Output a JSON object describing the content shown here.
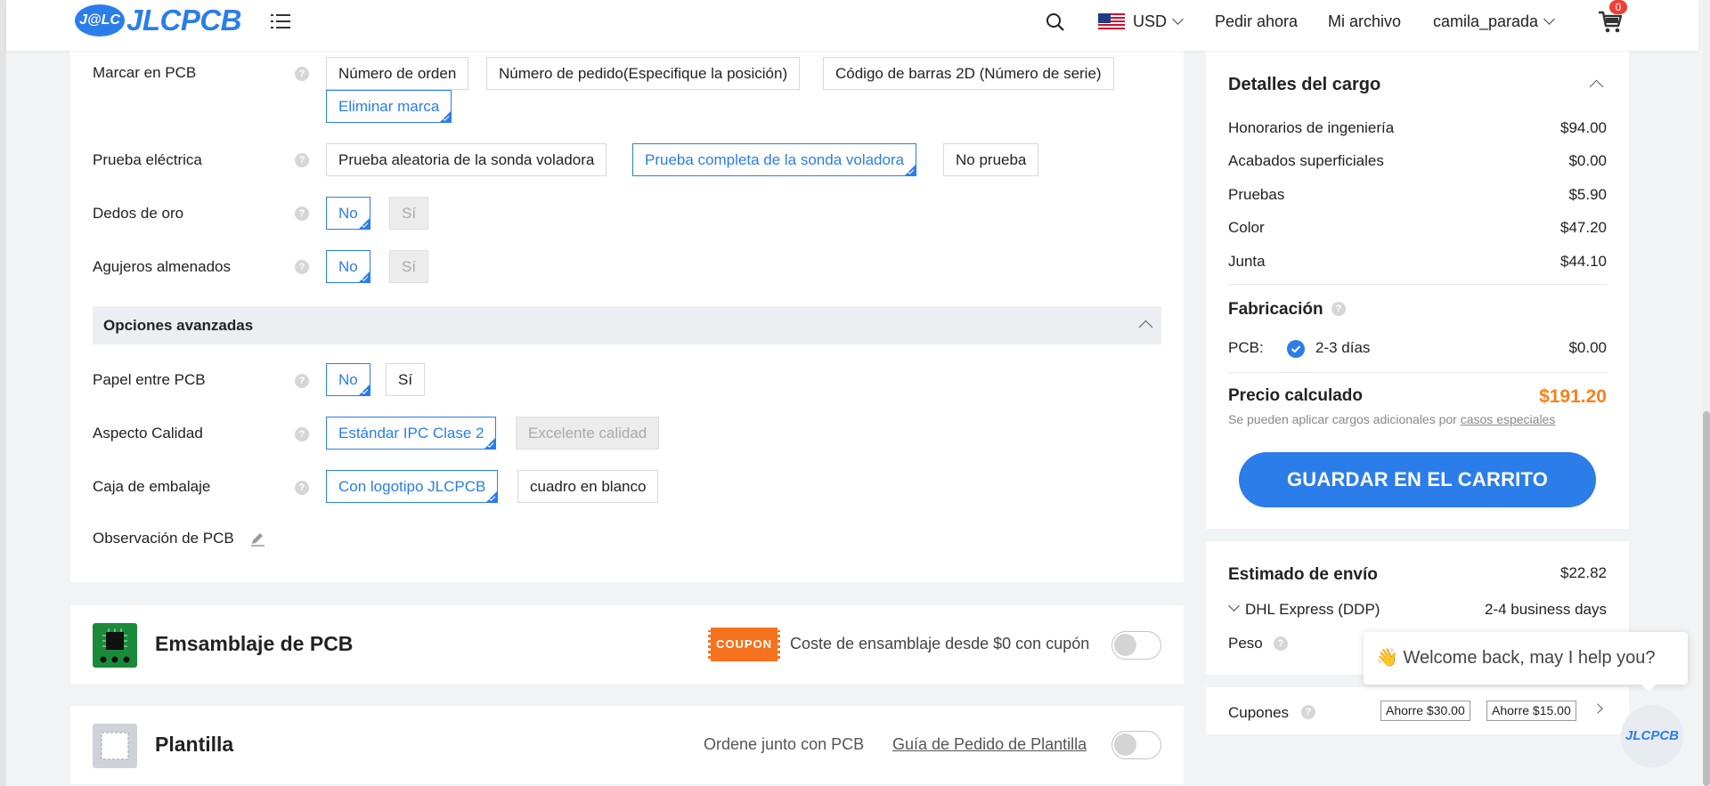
{
  "header": {
    "logo_badge": "J@LC",
    "logo_text": "JLCPCB",
    "currency": "USD",
    "order_now": "Pedir ahora",
    "my_files": "Mi archivo",
    "username": "camila_parada",
    "cart_count": "0"
  },
  "options": {
    "mark_pcb": {
      "label": "Marcar en PCB",
      "choices": [
        "Número de orden",
        "Número de pedido(Especifique la posición)",
        "Código de barras 2D (Número de serie)",
        "Eliminar marca"
      ],
      "selected": "Eliminar marca"
    },
    "electrical_test": {
      "label": "Prueba eléctrica",
      "choices": [
        "Prueba aleatoria de la sonda voladora",
        "Prueba completa de la sonda voladora",
        "No prueba"
      ],
      "selected": "Prueba completa de la sonda voladora"
    },
    "gold_fingers": {
      "label": "Dedos de oro",
      "choices": [
        "No",
        "Sí"
      ],
      "selected": "No"
    },
    "castellated_holes": {
      "label": "Agujeros almenados",
      "choices": [
        "No",
        "Sí"
      ],
      "selected": "No"
    },
    "advanced_title": "Opciones avanzadas",
    "paper_between": {
      "label": "Papel entre PCB",
      "choices": [
        "No",
        "Sí"
      ],
      "selected": "No"
    },
    "quality": {
      "label": "Aspecto Calidad",
      "choices": [
        "Estándar IPC Clase 2",
        "Excelente calidad"
      ],
      "selected": "Estándar IPC Clase 2"
    },
    "packaging": {
      "label": "Caja de embalaje",
      "choices": [
        "Con logotipo JLCPCB",
        "cuadro en blanco"
      ],
      "selected": "Con logotipo JLCPCB"
    },
    "remark": {
      "label": "Observación de PCB"
    }
  },
  "assembly": {
    "title": "Emsamblaje de PCB",
    "coupon_badge": "COUPON",
    "coupon_text": "Coste de ensamblaje desde $0 con cupón",
    "enabled": false
  },
  "stencil": {
    "title": "Plantilla",
    "order_together": "Ordene junto con PCB",
    "guide_link": "Guía de Pedido de Plantilla",
    "enabled": false
  },
  "charges": {
    "title": "Detalles del cargo",
    "items": [
      {
        "label": "Honorarios de ingeniería",
        "value": "$94.00"
      },
      {
        "label": "Acabados superficiales",
        "value": "$0.00"
      },
      {
        "label": "Pruebas",
        "value": "$5.90"
      },
      {
        "label": "Color",
        "value": "$47.20"
      },
      {
        "label": "Junta",
        "value": "$44.10"
      }
    ],
    "fab_title": "Fabricación",
    "pcb_label": "PCB:",
    "pcb_days": "2-3 días",
    "pcb_value": "$0.00",
    "calc_label": "Precio calculado",
    "calc_value": "$191.20",
    "note_prefix": "Se pueden aplicar cargos adicionales por",
    "note_link": "casos especiales",
    "save_cart": "GUARDAR EN EL CARRITO"
  },
  "shipping": {
    "title": "Estimado de envío",
    "value": "$22.82",
    "method": "DHL Express (DDP)",
    "time": "2-4 business days",
    "weight_label": "Peso"
  },
  "coupons": {
    "label": "Cupones",
    "tags": [
      "Ahorre $30.00",
      "Ahorre $15.00"
    ]
  },
  "chat": {
    "message": "👋 Welcome back, may I help you?",
    "fab_label": "JLCPCB"
  },
  "colors": {
    "accent": "#2b7de9",
    "price": "#f7811a",
    "coupon_orange": "#f5731e"
  }
}
